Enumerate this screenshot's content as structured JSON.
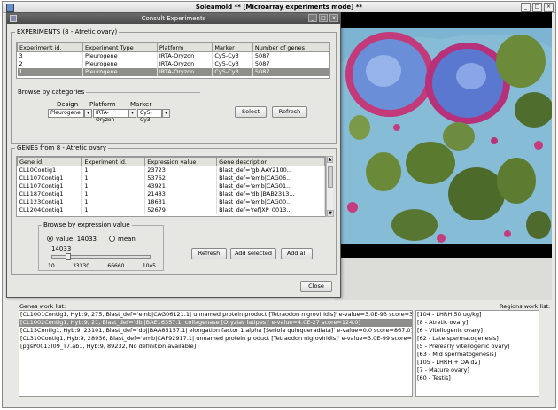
{
  "window": {
    "title": "Soleamold  ** [Microarray experiments mode] **"
  },
  "dialog": {
    "title": "Consult Experiments",
    "experiments_group": "EXPERIMENTS (8 - Atretic ovary)",
    "experiments_columns": [
      "Experiment id.",
      "Experiment Type",
      "Platform",
      "Marker",
      "Number of genes"
    ],
    "experiments_rows": [
      [
        "3",
        "Pleurogene",
        "IRTA-Oryzon",
        "Cy5-Cy3",
        "5087"
      ],
      [
        "2",
        "Pleurogene",
        "IRTA-Oryzon",
        "Cy5-Cy3",
        "5087"
      ],
      [
        "1",
        "Pleurogene",
        "IRTA-Oryzon",
        "Cy5-Cy3",
        "5087"
      ]
    ],
    "browse_categories": {
      "label": "Browse by categories",
      "design_label": "Design",
      "platform_label": "Platform",
      "marker_label": "Marker",
      "design_value": "Pleurogene",
      "platform_value": "IRTA-Oryzon",
      "marker_value": "Cy5-Cy3"
    },
    "select_button": "Select",
    "refresh_button": "Refresh",
    "genes_group": "GENES from 8 - Atretic ovary",
    "genes_columns": [
      "Gene id.",
      "Experiment id.",
      "Expression value",
      "Gene description"
    ],
    "genes_rows": [
      [
        "CL10Contig1",
        "1",
        "23723",
        "Blast_def='gb|AAY2100..."
      ],
      [
        "CL1107Contig1",
        "1",
        "53762",
        "Blast_def='emb|CAG06..."
      ],
      [
        "CL1107Contig1",
        "1",
        "43921",
        "Blast_def='emb|CAG01..."
      ],
      [
        "CL1187Contig1",
        "1",
        "21483",
        "Blast_def='dbj|BAB2313..."
      ],
      [
        "CL1123Contig1",
        "1",
        "18631",
        "Blast_def='emb|CAG00..."
      ],
      [
        "CL1204Contig1",
        "1",
        "52679",
        "Blast_def='ref|XP_0013..."
      ]
    ],
    "browse_expression": {
      "label": "Browse by expression value",
      "value_option": "value: 14033",
      "mean_option": "mean",
      "current_value": "14033",
      "slider_level": 14033,
      "slider_max": 100000,
      "ticks": [
        "10",
        "33330",
        "66660",
        "10e5"
      ]
    },
    "refresh2_button": "Refresh",
    "add_selected_button": "Add selected",
    "add_all_button": "Add all",
    "close_button": "Close"
  },
  "genes_work_list": {
    "label": "Genes work list:",
    "items": [
      "[CL1001Contig1, Hyb:9, 275,  Blast_def='emb|CAG06121.1| unnamed protein product [Tetraodon nigroviridis]' e-value=3.0E-93 score=344.0]",
      "[CL1002Contig1, Hyb:9, 21,  Blast_def='dbj|BAE16357.1| collagenase [Oryzias latipes]' e-value=4.0E-27 score=124.0]",
      "[CL13Contig1, Hyb:9, 23101,  Blast_def='dbj|BAA85157.1| elongation factor 1 alpha [Seriola quinqueradiata]' e-value=0.0 score=867.0]",
      "[CL310Contig1, Hyb:9, 28936,  Blast_def='emb|CAF92917.1| unnamed protein product [Tetraodon nigroviridis]' e-value=3.0E-99 score=365.0]",
      "[pgsP0013I09_T7.ab1, Hyb:9, 89232,  No definition available]"
    ],
    "selected_index": 1
  },
  "regions_work_list": {
    "label": "Regions work list:",
    "items": [
      "[104 - LHRH 50 ug/kg]",
      "[8 - Atretic ovary]",
      "[6 - Vitellogenic ovary]",
      "[62 - Late spermatogenesis]",
      "[5 - Pre/early vitellogenic ovary]",
      "[63 - Mid spermatogenesis]",
      "[105 - LHRH + OA d2]",
      "[7 - Mature ovary]",
      "[60 - Testis]"
    ]
  },
  "colors": {
    "selected_row": "#8e8e8a",
    "image_background": "#000000",
    "tissue_blue": "#5a7fd0",
    "tissue_green": "#4a6a30",
    "tissue_pink": "#c03878"
  }
}
